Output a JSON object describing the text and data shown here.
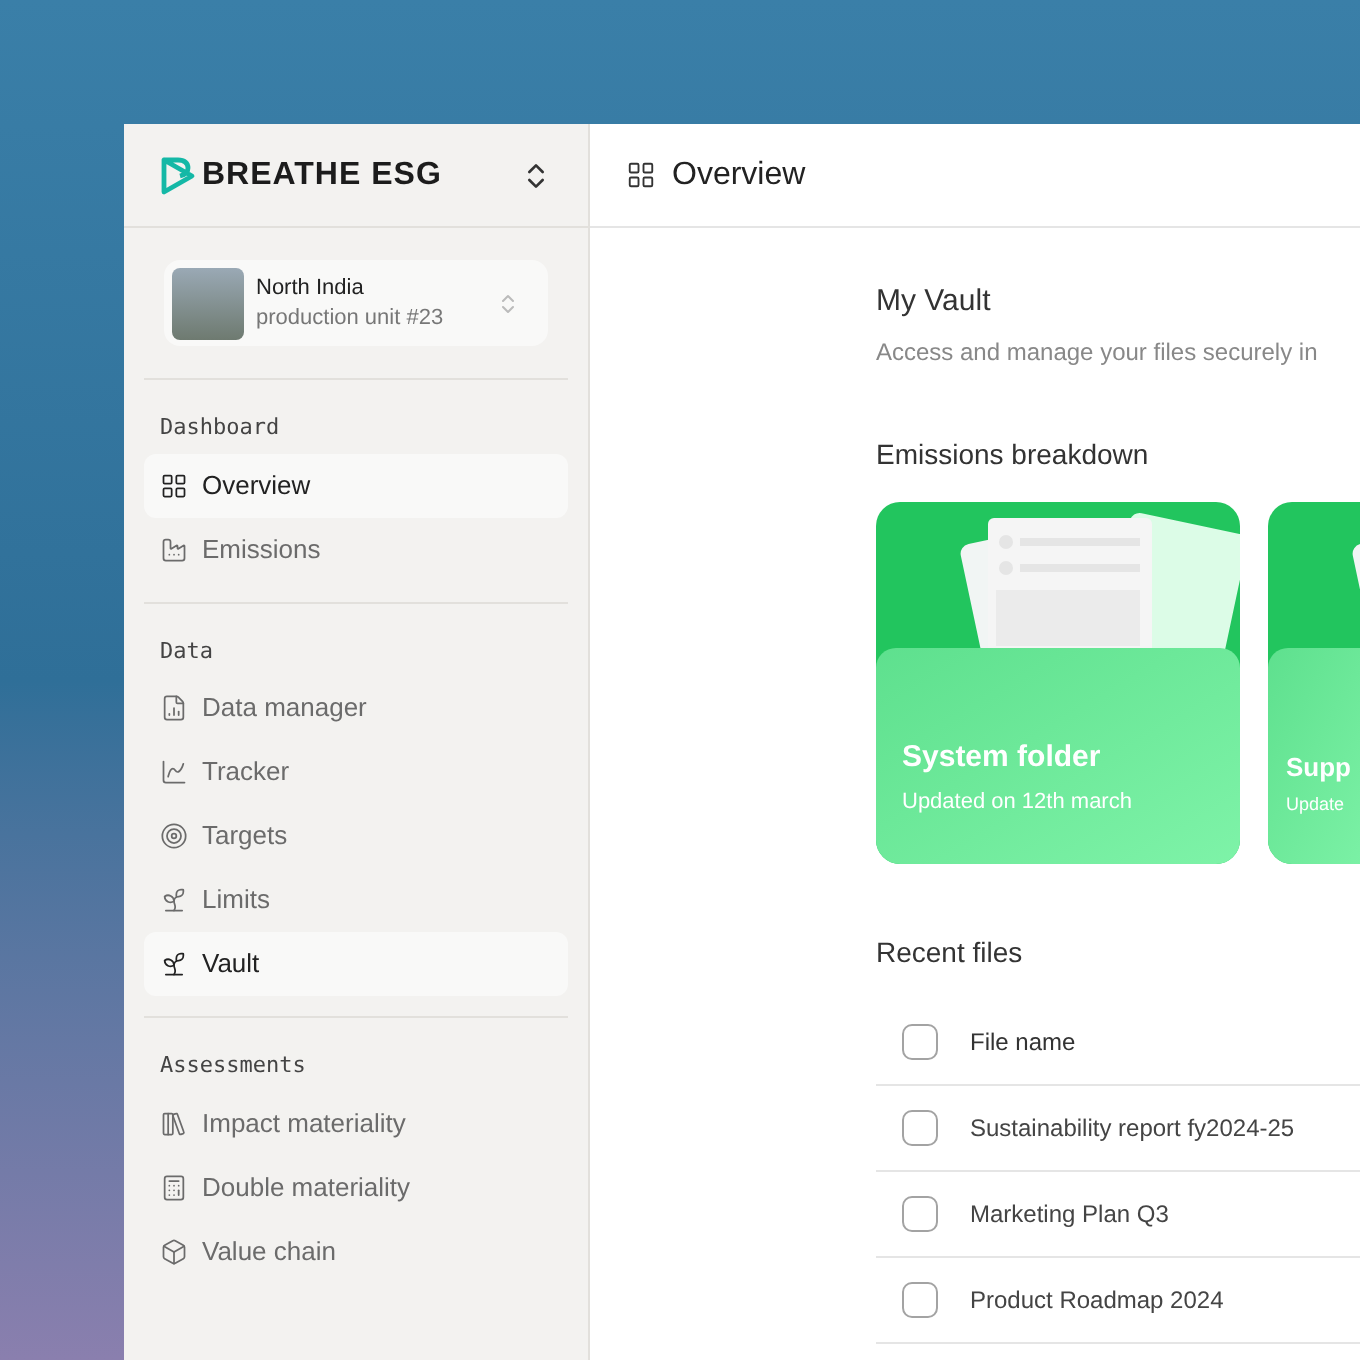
{
  "brand": {
    "name": "BREATHE ESG"
  },
  "location": {
    "title": "North India",
    "subtitle": "production unit #23"
  },
  "sidebar": {
    "sections": [
      {
        "title": "Dashboard",
        "items": [
          {
            "label": "Overview",
            "selected": true
          },
          {
            "label": "Emissions",
            "selected": false
          }
        ]
      },
      {
        "title": "Data",
        "items": [
          {
            "label": "Data manager",
            "selected": false
          },
          {
            "label": "Tracker",
            "selected": false
          },
          {
            "label": "Targets",
            "selected": false
          },
          {
            "label": "Limits",
            "selected": false
          },
          {
            "label": "Vault",
            "selected": true
          }
        ]
      },
      {
        "title": "Assessments",
        "items": [
          {
            "label": "Impact materiality",
            "selected": false
          },
          {
            "label": "Double materiality",
            "selected": false
          },
          {
            "label": "Value chain",
            "selected": false
          }
        ]
      }
    ]
  },
  "header": {
    "title": "Overview"
  },
  "page": {
    "title": "My Vault",
    "subtitle": "Access and manage your files securely in"
  },
  "folders": {
    "title": "Emissions breakdown",
    "items": [
      {
        "name": "System folder",
        "updated": "Updated on 12th march"
      },
      {
        "name": "Supp",
        "updated": "Update"
      }
    ]
  },
  "recent_files": {
    "title": "Recent files",
    "header": {
      "label": "File name",
      "checked": false
    },
    "rows": [
      {
        "name": "Sustainability report fy2024-25",
        "checked": false
      },
      {
        "name": "Marketing Plan Q3",
        "checked": false
      },
      {
        "name": "Product Roadmap 2024",
        "checked": false
      }
    ]
  }
}
